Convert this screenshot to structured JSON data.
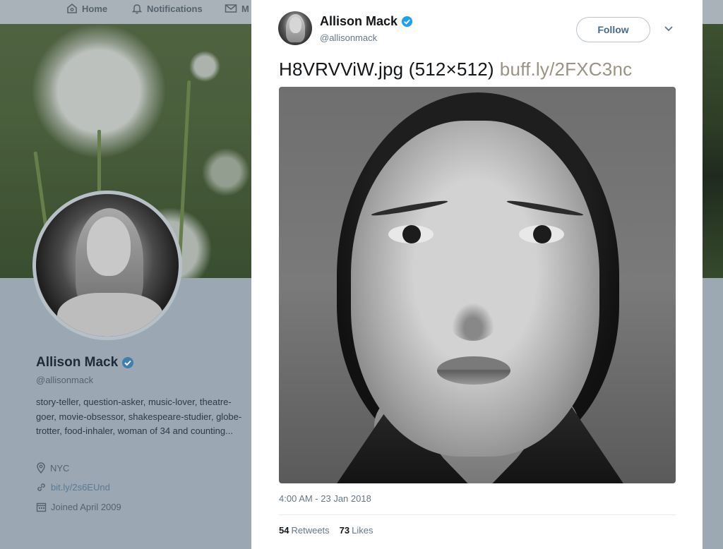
{
  "nav": {
    "home_label": "Home",
    "notifications_label": "Notifications",
    "messages_label": "M"
  },
  "profile": {
    "name": "Allison Mack",
    "handle": "@allisonmack",
    "bio": "story-teller, question-asker, music-lover, theatre-goer, movie-obsessor, shakespeare-studier, globe-trotter, food-inhaler, woman of 34 and counting...",
    "location": "NYC",
    "link": "bit.ly/2s6EUnd",
    "joined": "Joined April 2009"
  },
  "tweet": {
    "author_name": "Allison Mack",
    "author_handle": "@allisonmack",
    "follow_label": "Follow",
    "text": "H8VRVViW.jpg (512×512)",
    "link_text": "buff.ly/2FXC3nc",
    "timestamp": "4:00 AM - 23 Jan 2018",
    "retweets_count": "54",
    "retweets_label": "Retweets",
    "likes_count": "73",
    "likes_label": "Likes"
  },
  "colors": {
    "verified_blue": "#1da1f2",
    "link_tan": "#9a9283",
    "follow_text": "#4a6b86",
    "card_bg": "#ffffff",
    "dim_overlay": "#9aa7b1"
  },
  "icons": {
    "home": "home-icon",
    "notifications": "bell-icon",
    "messages": "envelope-icon",
    "verified": "verified-badge-icon",
    "location": "location-pin-icon",
    "link": "link-icon",
    "calendar": "calendar-icon",
    "caret": "chevron-down-icon"
  }
}
